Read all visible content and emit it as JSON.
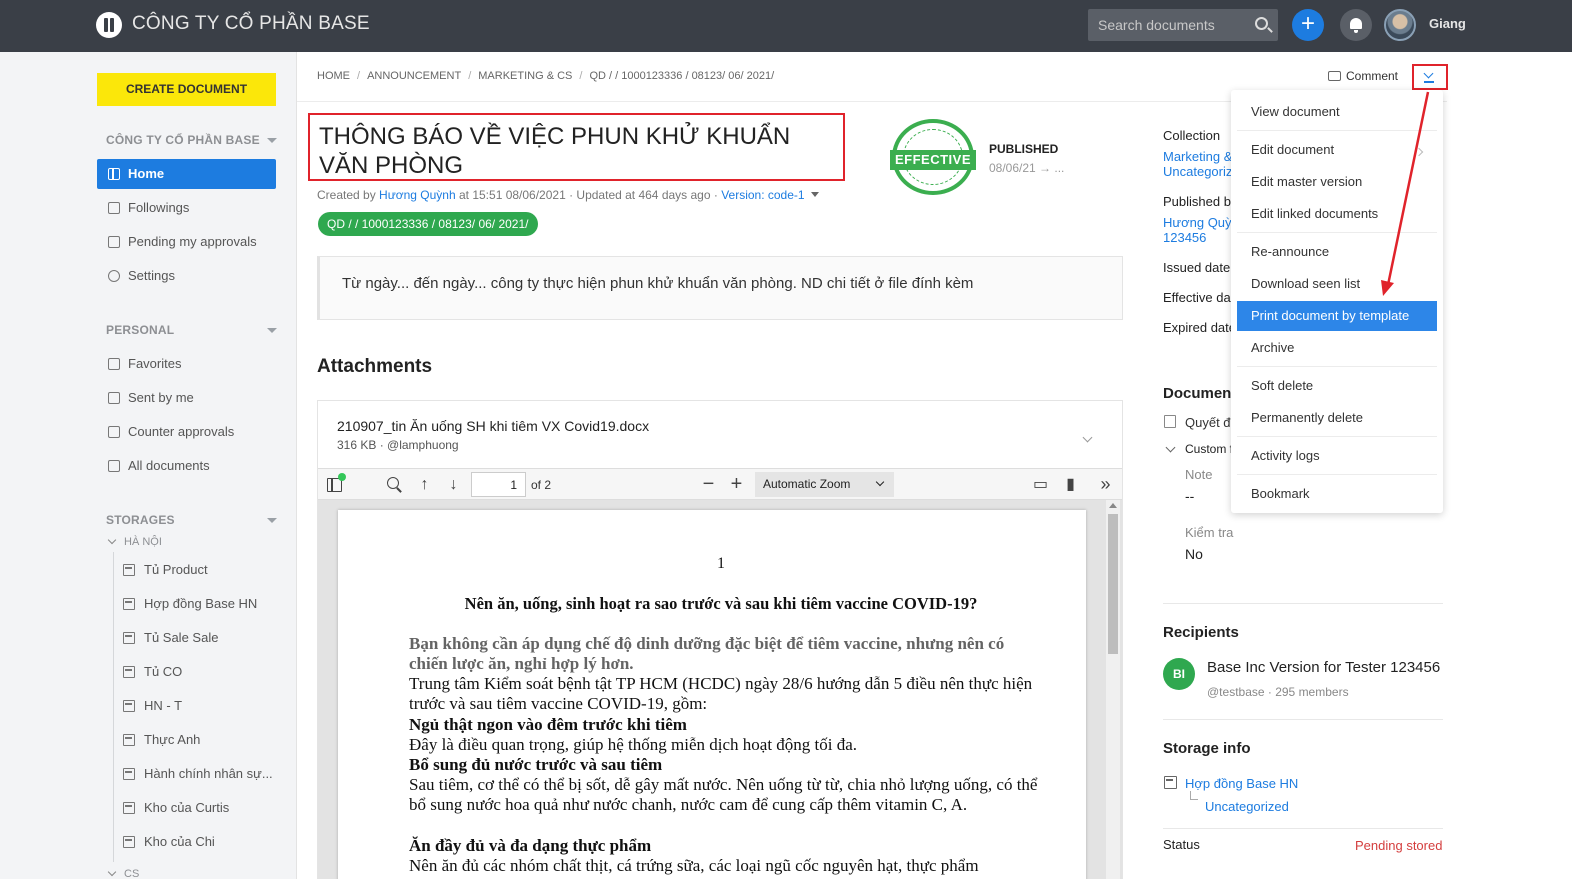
{
  "header": {
    "company": "CÔNG TY CỔ PHẦN BASE",
    "search_placeholder": "Search documents",
    "add_label": "+",
    "user_name": "Giang"
  },
  "sidebar": {
    "create_label": "CREATE DOCUMENT",
    "company_section": "CÔNG TY CỔ PHẦN BASE",
    "main_items": [
      {
        "label": "Home",
        "icon": "grid-icon",
        "active": true
      },
      {
        "label": "Followings",
        "icon": "trend-icon"
      },
      {
        "label": "Pending my approvals",
        "icon": "clipboard-icon"
      },
      {
        "label": "Settings",
        "icon": "gear-icon"
      }
    ],
    "personal_section": "PERSONAL",
    "personal_items": [
      {
        "label": "Favorites",
        "icon": "bookmark-file-icon"
      },
      {
        "label": "Sent by me",
        "icon": "document-icon"
      },
      {
        "label": "Counter approvals",
        "icon": "copy-icon"
      },
      {
        "label": "All documents",
        "icon": "folder-grid-icon"
      }
    ],
    "storages_section": "STORAGES",
    "storage_group": "HÀ NỘI",
    "storage_items": [
      "Tủ Product",
      "Hợp đồng Base HN",
      "Tủ Sale Sale",
      "Tủ CO",
      "HN - T",
      "Thực Anh",
      "Hành chính nhân sự...",
      "Kho của Curtis",
      "Kho của Chi"
    ],
    "next_group": "CS"
  },
  "breadcrumb": [
    "HOME",
    "ANNOUNCEMENT",
    "MARKETING & CS",
    "QD / / 1000123336 / 08123/ 06/ 2021/"
  ],
  "toolbar": {
    "comment_label": "Comment"
  },
  "document": {
    "title": "THÔNG BÁO VỀ VIỆC PHUN KHỬ KHUẨN VĂN PHÒNG",
    "stamp_text": "EFFECTIVE",
    "status": "PUBLISHED",
    "status_date": "08/06/21 → ...",
    "created_prefix": "Created by ",
    "author": "Hương Quỳnh",
    "created_suffix": " at 15:51 08/06/2021 · Updated at 464 days ago · ",
    "version": "Version: code-1",
    "code": "QD / / 1000123336 / 08123/ 06/ 2021/",
    "description": "Từ ngày... đến ngày... công ty thực hiện phun khử khuẩn văn phòng. ND chi tiết ở file đính kèm"
  },
  "attachments": {
    "title": "Attachments",
    "file_name": "210907_tin Ăn uống SH khi tiêm VX Covid19.docx",
    "file_meta": "316 KB · @lamphuong",
    "viewer": {
      "page_value": "1",
      "page_of": "of 2",
      "zoom": "Automatic Zoom"
    },
    "page_content": {
      "page_number": "1",
      "heading": "Nên ăn, uống, sinh hoạt ra sao trước và sau khi tiêm vaccine COVID-19?",
      "subheading": "Bạn không cần áp dụng chế độ dinh dưỡng đặc biệt để tiêm vaccine, nhưng nên có chiến lược ăn, nghỉ hợp lý hơn.",
      "p1": "Trung tâm Kiểm soát bệnh tật TP HCM (HCDC) ngày 28/6 hướng dẫn 5 điều nên thực hiện trước và sau tiêm vaccine COVID-19, gồm:",
      "h1": "Ngủ thật ngon vào đêm trước khi tiêm",
      "p2": "Đây là điều quan trọng, giúp hệ thống miễn dịch hoạt động tối đa.",
      "h2": "Bổ sung đủ nước trước và sau tiêm",
      "p3": "Sau tiêm, cơ thể có thể bị sốt, dễ gây mất nước. Nên uống từ từ, chia nhỏ lượng uống, có thể bổ sung nước hoa quả như nước chanh, nước cam để cung cấp thêm vitamin C, A.",
      "h3": "Ăn đầy đủ và đa dạng thực phẩm",
      "p4": "Nên ăn đủ các nhóm chất thịt, cá trứng sữa, các loại ngũ cốc nguyên hạt, thực phẩm"
    }
  },
  "right_panel": {
    "collection_label": "Collection",
    "collection_link1": "Marketing &",
    "collection_link2": "Uncategoriz",
    "published_by_label": "Published b",
    "published_by_link": "Hương Quỳn",
    "published_by_id": "123456",
    "issued_label": "Issued date",
    "effective_label": "Effective da",
    "expired_label": "Expired date",
    "document_heading": "Document",
    "doc_item": "Quyết đị",
    "custom_label": "Custom f",
    "note_label": "Note",
    "note_value": "--",
    "check_label": "Kiểm tra",
    "check_value": "No",
    "recipients_heading": "Recipients",
    "recipient_initials": "BI",
    "recipient_name": "Base Inc Version for Tester 123456",
    "recipient_meta": "@testbase · 295 members",
    "storage_heading": "Storage info",
    "storage_link": "Hợp đồng Base HN",
    "storage_sub": "Uncategorized",
    "status_label": "Status",
    "status_value": "Pending stored"
  },
  "menu": {
    "items": [
      "View document",
      "Edit document",
      "Edit master version",
      "Edit linked documents",
      "Re-announce",
      "Download seen list",
      "Print document by template",
      "Archive",
      "Soft delete",
      "Permanently delete",
      "Activity logs",
      "Bookmark"
    ],
    "active_item": "Print document by template"
  },
  "colors": {
    "topbar": "#3a3f47",
    "accent": "#1d7ce0",
    "create": "#fbe70a",
    "effective_green": "#3bae4f",
    "annotation_red": "#e0232b"
  }
}
